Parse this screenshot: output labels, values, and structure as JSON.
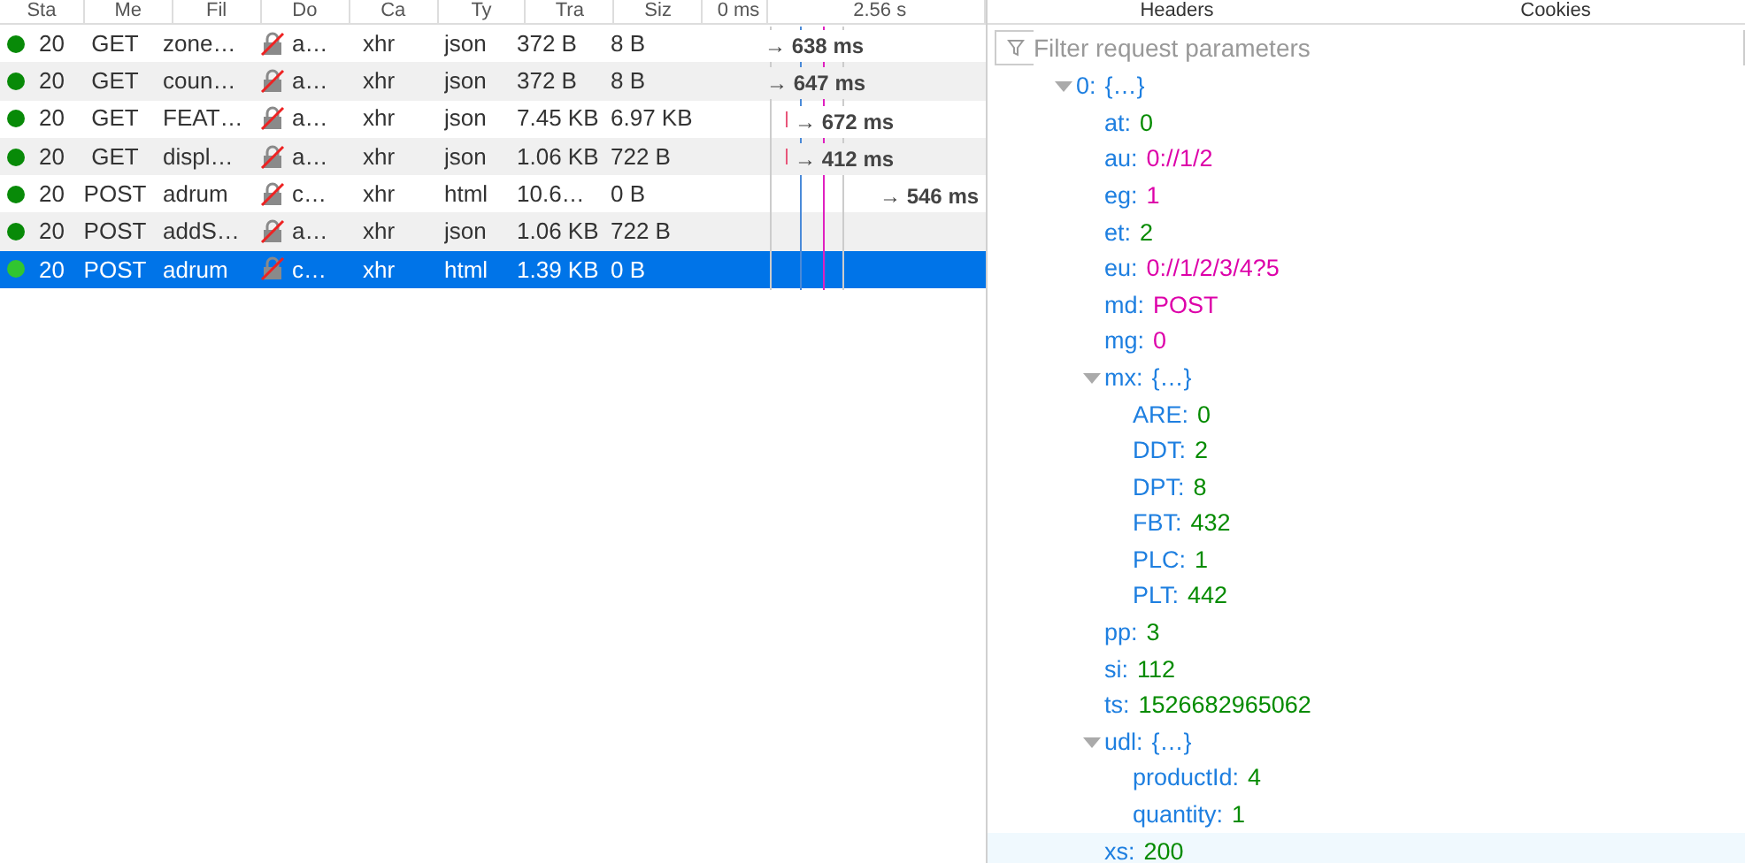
{
  "requests": {
    "columns": [
      "Sta",
      "Me",
      "Fil",
      "Do",
      "Ca",
      "Ty",
      "Tra",
      "Siz",
      "0 ms",
      "2.56 s"
    ],
    "rows": [
      {
        "status": "20",
        "method": "GET",
        "file": "zone…",
        "domain": "a…",
        "cause": "xhr",
        "type": "json",
        "transferred": "372 B",
        "size": "8 B",
        "timing": "→ 638 ms",
        "selected": false
      },
      {
        "status": "20",
        "method": "GET",
        "file": "coun…",
        "domain": "a…",
        "cause": "xhr",
        "type": "json",
        "transferred": "372 B",
        "size": "8 B",
        "timing": "→ 647 ms",
        "selected": false
      },
      {
        "status": "20",
        "method": "GET",
        "file": "FEAT…",
        "domain": "a…",
        "cause": "xhr",
        "type": "json",
        "transferred": "7.45 KB",
        "size": "6.97 KB",
        "timing": "→ 672 ms",
        "selected": false
      },
      {
        "status": "20",
        "method": "GET",
        "file": "displ…",
        "domain": "a…",
        "cause": "xhr",
        "type": "json",
        "transferred": "1.06 KB",
        "size": "722 B",
        "timing": "→ 412 ms",
        "selected": false
      },
      {
        "status": "20",
        "method": "POST",
        "file": "adrum",
        "domain": "c…",
        "cause": "xhr",
        "type": "html",
        "transferred": "10.6…",
        "size": "0 B",
        "timing": "→ 546 ms",
        "selected": false
      },
      {
        "status": "20",
        "method": "POST",
        "file": "addS…",
        "domain": "a…",
        "cause": "xhr",
        "type": "json",
        "transferred": "1.06 KB",
        "size": "722 B",
        "selected": false
      },
      {
        "status": "20",
        "method": "POST",
        "file": "adrum",
        "domain": "c…",
        "cause": "xhr",
        "type": "html",
        "transferred": "1.39 KB",
        "size": "0 B",
        "selected": true
      }
    ]
  },
  "details": {
    "tabs": [
      "Headers",
      "Cookies"
    ],
    "filter": {
      "placeholder": "Filter request parameters"
    },
    "tree": [
      {
        "key": "0:",
        "value": "{…}",
        "kind": "object",
        "expanded": true,
        "children": [
          {
            "key": "at:",
            "value": "0",
            "kind": "number"
          },
          {
            "key": "au:",
            "value": "0://1/2",
            "kind": "string"
          },
          {
            "key": "eg:",
            "value": "1",
            "kind": "string"
          },
          {
            "key": "et:",
            "value": "2",
            "kind": "number"
          },
          {
            "key": "eu:",
            "value": "0://1/2/3/4?5",
            "kind": "string"
          },
          {
            "key": "md:",
            "value": "POST",
            "kind": "string"
          },
          {
            "key": "mg:",
            "value": "0",
            "kind": "string"
          },
          {
            "key": "mx:",
            "value": "{…}",
            "kind": "object",
            "expanded": true,
            "children": [
              {
                "key": "ARE:",
                "value": "0",
                "kind": "number"
              },
              {
                "key": "DDT:",
                "value": "2",
                "kind": "number"
              },
              {
                "key": "DPT:",
                "value": "8",
                "kind": "number"
              },
              {
                "key": "FBT:",
                "value": "432",
                "kind": "number"
              },
              {
                "key": "PLC:",
                "value": "1",
                "kind": "number"
              },
              {
                "key": "PLT:",
                "value": "442",
                "kind": "number"
              }
            ]
          },
          {
            "key": "pp:",
            "value": "3",
            "kind": "number"
          },
          {
            "key": "si:",
            "value": "112",
            "kind": "number"
          },
          {
            "key": "ts:",
            "value": "1526682965062",
            "kind": "number"
          },
          {
            "key": "udl:",
            "value": "{…}",
            "kind": "object",
            "expanded": true,
            "children": [
              {
                "key": "productId:",
                "value": "4",
                "kind": "number"
              },
              {
                "key": "quantity:",
                "value": "1",
                "kind": "number"
              }
            ]
          },
          {
            "key": "xs:",
            "value": "200",
            "kind": "number",
            "selected": true
          }
        ]
      }
    ]
  }
}
